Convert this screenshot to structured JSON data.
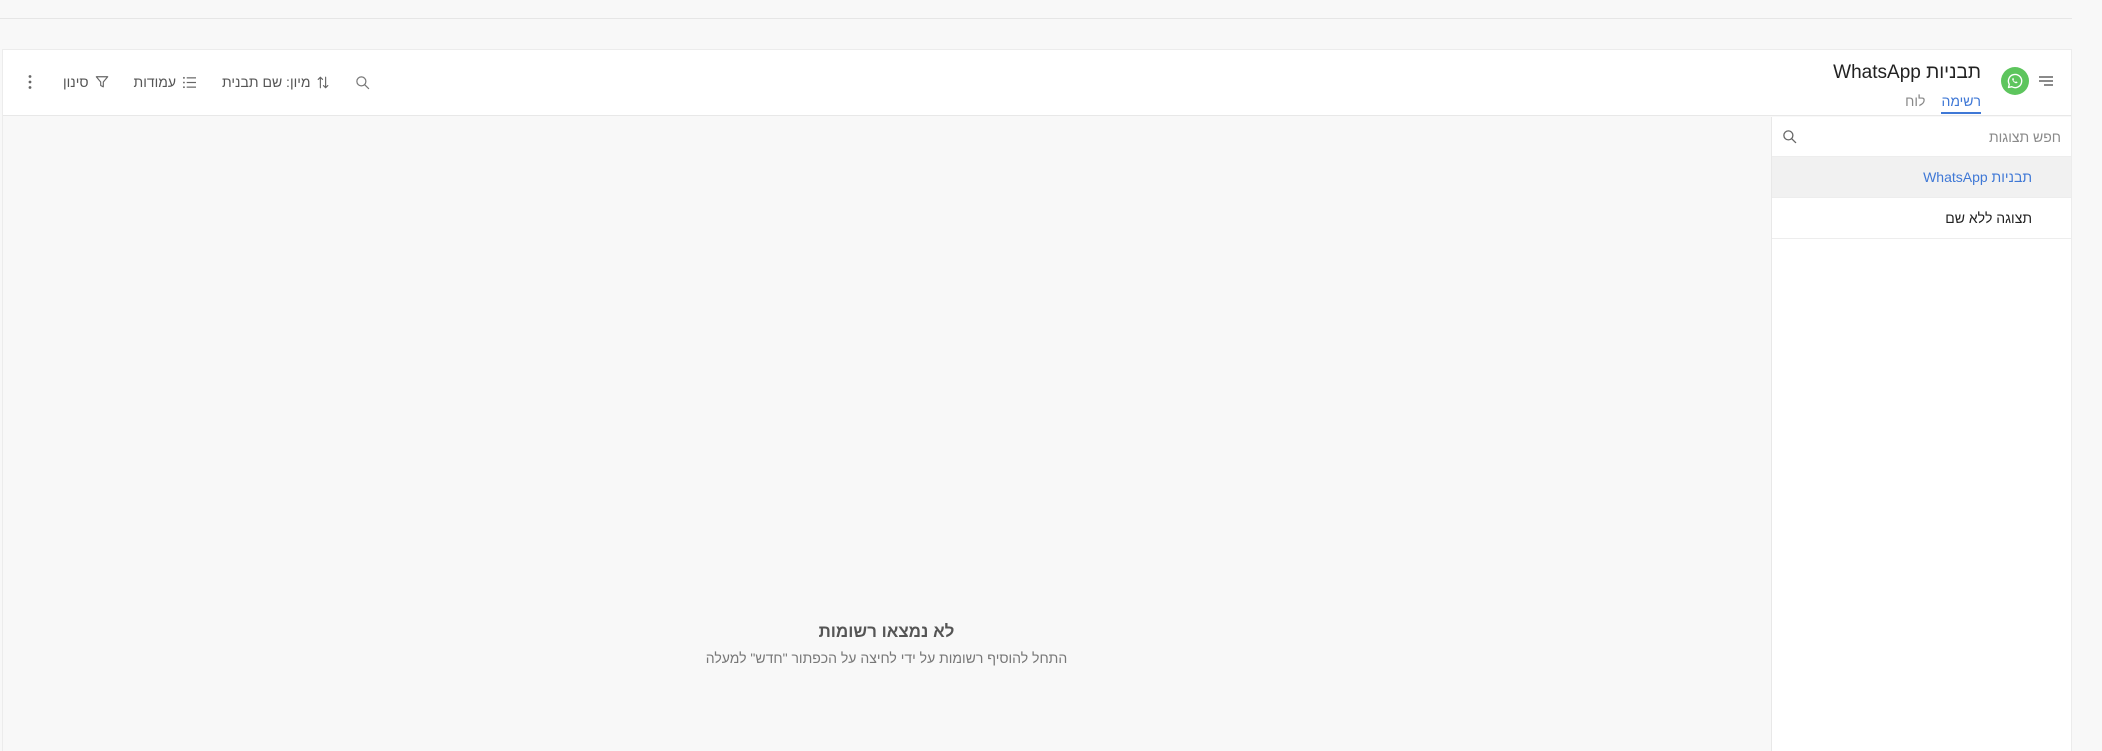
{
  "page": {
    "title": "תבניות WhatsApp"
  },
  "icons": {
    "menu": "menu-lines-icon",
    "logo": "whatsapp-icon",
    "more": "vertical-dots-icon",
    "filter": "funnel-icon",
    "columns": "list-icon",
    "sort": "sort-arrows-icon",
    "search": "search-icon"
  },
  "colors": {
    "accent": "#3f78d6",
    "logo_bg": "#5dc55d"
  },
  "tabs": [
    {
      "label": "רשימה",
      "active": true
    },
    {
      "label": "לוח",
      "active": false
    }
  ],
  "toolbar": {
    "filter_label": "סינון",
    "columns_label": "עמודות",
    "sort_label": "מיון: שם תבנית"
  },
  "sidebar": {
    "search_placeholder": "חפש תצוגות",
    "views": [
      {
        "label": "תבניות WhatsApp",
        "active": true
      },
      {
        "label": "תצוגה ללא שם",
        "active": false
      }
    ]
  },
  "empty_state": {
    "title": "לא נמצאו רשומות",
    "subtitle": "התחל להוסיף רשומות על ידי לחיצה על הכפתור \"חדש\" למעלה"
  }
}
